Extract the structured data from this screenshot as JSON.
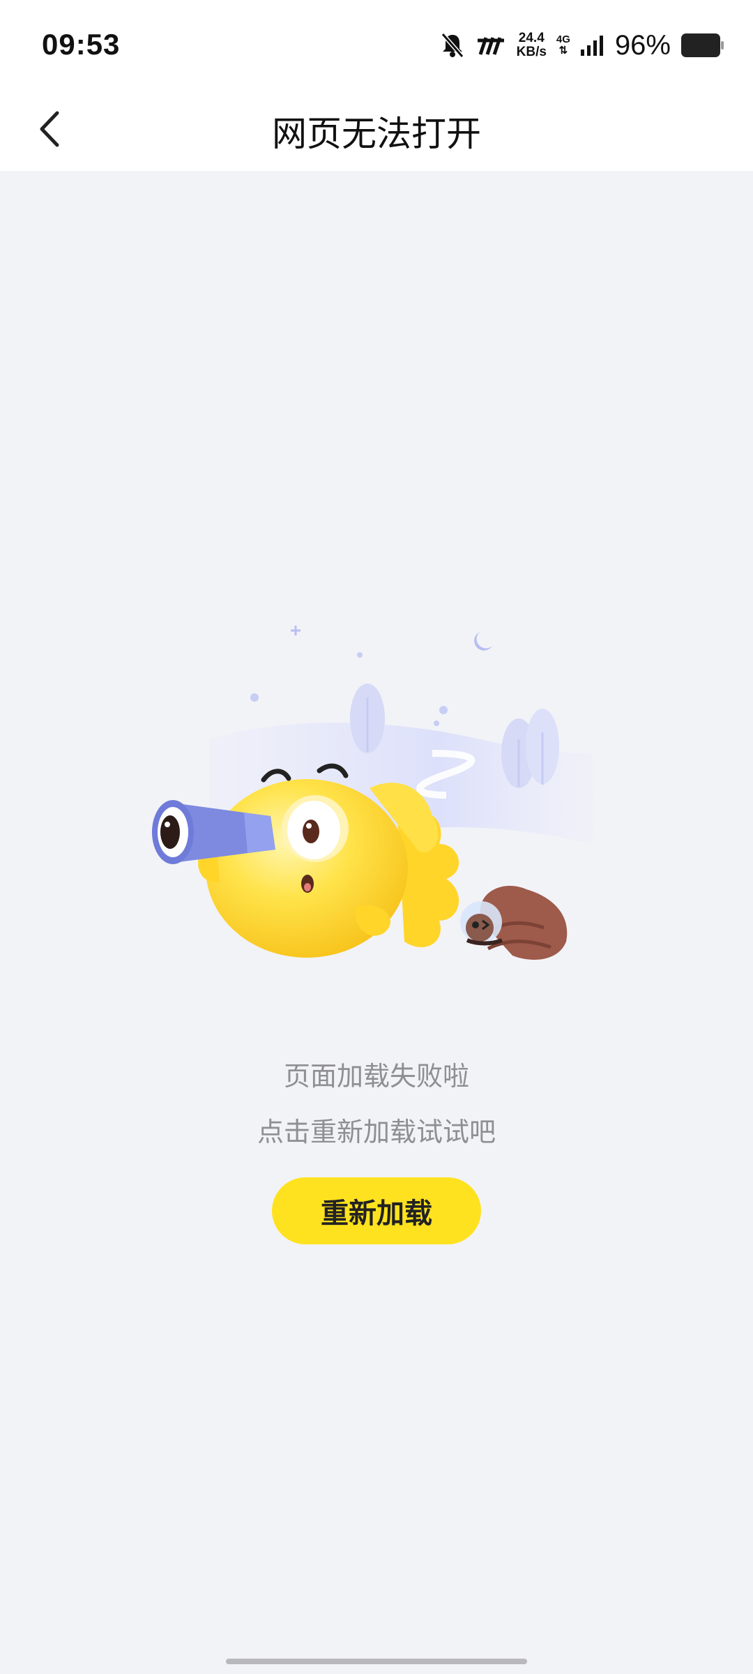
{
  "status_bar": {
    "time": "09:53",
    "net_speed_value": "24.4",
    "net_speed_unit": "KB/s",
    "net_type": "4G",
    "battery_percent": "96%"
  },
  "header": {
    "title": "网页无法打开",
    "back_icon": "chevron-left-icon"
  },
  "error": {
    "line1": "页面加载失败啦",
    "line2": "点击重新加载试试吧",
    "reload_label": "重新加载"
  },
  "colors": {
    "button_yellow": "#FFE21F",
    "page_background": "#F2F3F7",
    "message_gray": "#8E8E93"
  }
}
